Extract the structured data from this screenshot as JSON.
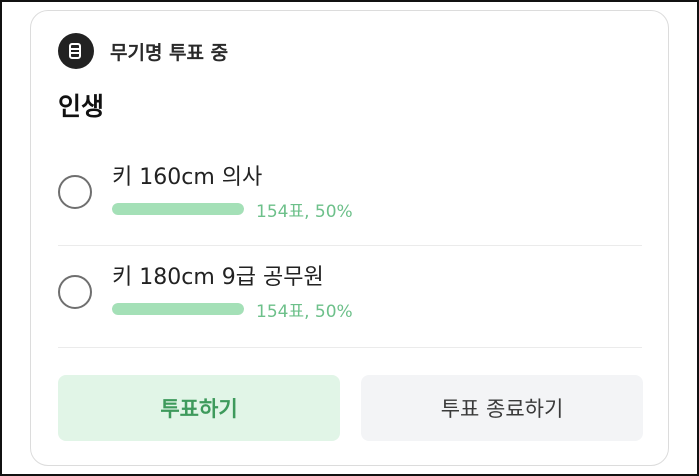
{
  "poll": {
    "header_label": "무기명 투표 중",
    "header_icon": "ballot-icon",
    "title": "인생",
    "options": [
      {
        "label": "키 160cm 의사",
        "result_text": "154표, 50%",
        "fraction": 0.5
      },
      {
        "label": "키 180cm 9급 공무원",
        "result_text": "154표, 50%",
        "fraction": 0.5
      }
    ],
    "vote_button_label": "투표하기",
    "end_button_label": "투표 종료하기",
    "colors": {
      "accent_green": "#6dc08a",
      "bar_green": "#a4e0b7",
      "vote_button_bg": "#e1f5e7"
    }
  }
}
